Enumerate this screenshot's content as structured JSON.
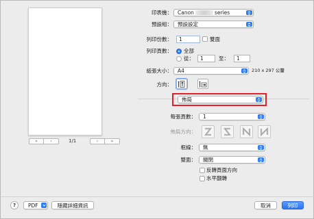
{
  "preview": {
    "page_indicator": "1/1"
  },
  "fields": {
    "printer": {
      "label": "印表機：",
      "value_prefix": "Canon",
      "value_suffix": "series"
    },
    "preset": {
      "label": "預設組：",
      "value": "預設設定"
    },
    "copies": {
      "label": "列印份數：",
      "value": "1",
      "duplex_label": "雙面"
    },
    "pages": {
      "label": "列印頁數：",
      "all_label": "全部",
      "from_label": "從：",
      "from_value": "1",
      "to_label": "至：",
      "to_value": "1"
    },
    "paper_size": {
      "label": "紙張大小：",
      "value": "A4",
      "dimensions": "210 x 297 公釐"
    },
    "orientation": {
      "label": "方向："
    },
    "section": {
      "value": "佈局"
    },
    "pages_per_sheet": {
      "label": "每張頁數：",
      "value": "1"
    },
    "layout_direction": {
      "label": "佈局方向："
    },
    "border": {
      "label": "框線：",
      "value": "無"
    },
    "two_sided": {
      "label": "雙面：",
      "value": "關閉"
    },
    "reverse_orientation_label": "反轉頁面方向",
    "flip_horizontal_label": "水平翻轉"
  },
  "bottom": {
    "help": "?",
    "pdf_label": "PDF",
    "hide_details_label": "隱藏詳細資訊",
    "cancel_label": "取消",
    "print_label": "列印"
  },
  "icons": {
    "chevron": "chevron-updown-icon",
    "pager_first": "«",
    "pager_prev": "‹",
    "pager_next": "›",
    "pager_last": "»"
  },
  "colors": {
    "accent": "#2f7df6",
    "highlight_box": "#e41f27"
  }
}
